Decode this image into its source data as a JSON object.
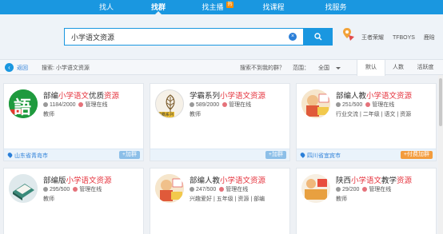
{
  "nav": {
    "items": [
      "找人",
      "找群",
      "找主播",
      "找课程",
      "找服务"
    ],
    "hot_badge": "热"
  },
  "search": {
    "value": "小学语文资源",
    "hot_tags": [
      "王者荣耀",
      "TFBOYS",
      "鹿晗"
    ]
  },
  "toolbar": {
    "back_label": "返回",
    "query_text": "搜索: 小学语文资源",
    "not_found": "搜索不到我的群？",
    "range_label": "范围：",
    "range_value": "全国",
    "tabs": [
      "默认",
      "人数",
      "活跃度"
    ]
  },
  "cards": [
    {
      "title_pre": "部编",
      "title_hl": "小学语文",
      "title_mid": "优质",
      "title_hl2": "资源",
      "members": "1184/2000",
      "admin": "管理在线",
      "tags": "教师",
      "location": "山东省青岛市",
      "join": "+加群"
    },
    {
      "title_pre": "学霸系列",
      "title_hl": "小学语文资源",
      "title_mid": "",
      "title_hl2": "",
      "members": "589/2000",
      "admin": "管理在线",
      "tags": "教师",
      "location": "",
      "join": "+加群"
    },
    {
      "title_pre": "部编人教",
      "title_hl": "小学语文资源",
      "title_mid": "",
      "title_hl2": "",
      "members": "251/500",
      "admin": "管理在线",
      "tags": "行业交流 | 二年级 | 语文 | 资源",
      "location": "四川省宜宾市",
      "join": "+付费加群"
    },
    {
      "title_pre": "部编版",
      "title_hl": "小学语文资源",
      "title_mid": "",
      "title_hl2": "",
      "members": "295/500",
      "admin": "管理在线",
      "tags": "教师",
      "location": "",
      "join": ""
    },
    {
      "title_pre": "部编人教",
      "title_hl": "小学语文资源",
      "title_mid": "",
      "title_hl2": "",
      "members": "247/500",
      "admin": "管理在线",
      "tags": "兴趣爱好 | 五年级 | 资源 | 部编",
      "location": "",
      "join": ""
    },
    {
      "title_pre": "陕西",
      "title_hl": "小学语文",
      "title_mid": "教学",
      "title_hl2": "资源",
      "members": "29/200",
      "admin": "管理在线",
      "tags": "教师",
      "location": "",
      "join": ""
    }
  ],
  "avatar_text": {
    "card0": "語",
    "card1_sub": "学霸系列"
  },
  "colors": {
    "accent": "#1a97e0",
    "highlight": "#e5333d",
    "paid": "#f39c3d"
  }
}
